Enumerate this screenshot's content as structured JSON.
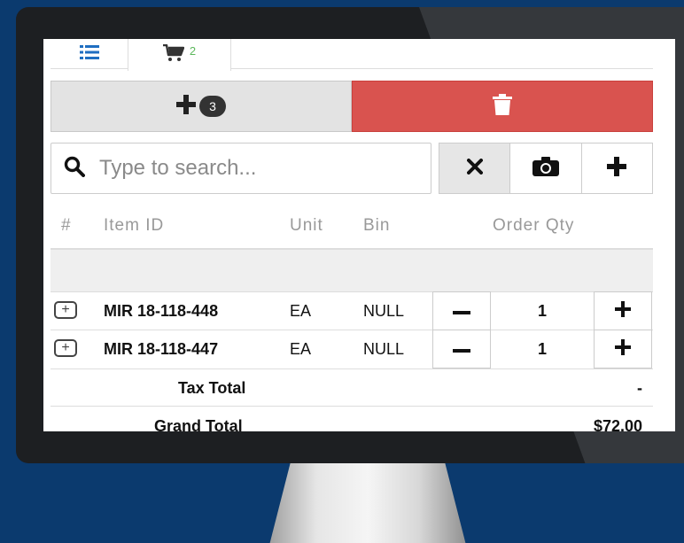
{
  "tabs": [
    {
      "icon": "list-icon"
    },
    {
      "icon": "cart-icon",
      "count": "2"
    }
  ],
  "actions": {
    "add_badge": "3",
    "add_icon": "plus-icon",
    "delete_icon": "trash-icon"
  },
  "search": {
    "placeholder": "Type to search...",
    "value": "",
    "buttons": [
      "clear-icon",
      "camera-icon",
      "plus-icon"
    ]
  },
  "table": {
    "headers": [
      "#",
      "Item ID",
      "Unit",
      "Bin",
      "Order Qty"
    ],
    "rows": [
      {
        "item_id": "MIR 18-118-448",
        "unit": "EA",
        "bin": "NULL",
        "qty": "1"
      },
      {
        "item_id": "MIR 18-118-447",
        "unit": "EA",
        "bin": "NULL",
        "qty": "1"
      }
    ]
  },
  "totals": {
    "tax_label": "Tax Total",
    "tax_value": "-",
    "grand_label": "Grand Total",
    "grand_value": "$72.00"
  },
  "colors": {
    "background": "#0b3a6e",
    "danger": "#d9534f",
    "success": "#5cb85c",
    "tab_icon": "#1f6ec1"
  }
}
